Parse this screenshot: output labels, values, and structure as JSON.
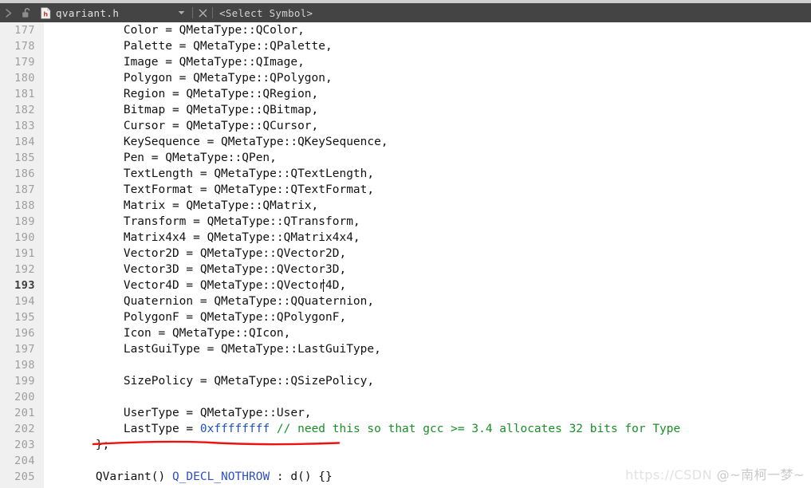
{
  "toolbar": {
    "nav_forward_icon": "chevron-right-icon",
    "lock_icon": "unlocked-padlock-icon",
    "file_type_icon": "header-file-icon",
    "file_type_letter": "h",
    "filename": "qvariant.h",
    "dropdown_icon": "chevron-down-icon",
    "close_icon": "close-x-icon",
    "select_symbol_label": "<Select Symbol>"
  },
  "editor": {
    "current_line": 193,
    "first_line": 177,
    "last_line": 205,
    "lines": [
      {
        "number": "177",
        "indent": "        ",
        "text": "Color = QMetaType::QColor,"
      },
      {
        "number": "178",
        "indent": "        ",
        "text": "Palette = QMetaType::QPalette,"
      },
      {
        "number": "179",
        "indent": "        ",
        "text": "Image = QMetaType::QImage,"
      },
      {
        "number": "180",
        "indent": "        ",
        "text": "Polygon = QMetaType::QPolygon,"
      },
      {
        "number": "181",
        "indent": "        ",
        "text": "Region = QMetaType::QRegion,"
      },
      {
        "number": "182",
        "indent": "        ",
        "text": "Bitmap = QMetaType::QBitmap,"
      },
      {
        "number": "183",
        "indent": "        ",
        "text": "Cursor = QMetaType::QCursor,"
      },
      {
        "number": "184",
        "indent": "        ",
        "text": "KeySequence = QMetaType::QKeySequence,"
      },
      {
        "number": "185",
        "indent": "        ",
        "text": "Pen = QMetaType::QPen,"
      },
      {
        "number": "186",
        "indent": "        ",
        "text": "TextLength = QMetaType::QTextLength,"
      },
      {
        "number": "187",
        "indent": "        ",
        "text": "TextFormat = QMetaType::QTextFormat,"
      },
      {
        "number": "188",
        "indent": "        ",
        "text": "Matrix = QMetaType::QMatrix,"
      },
      {
        "number": "189",
        "indent": "        ",
        "text": "Transform = QMetaType::QTransform,"
      },
      {
        "number": "190",
        "indent": "        ",
        "text": "Matrix4x4 = QMetaType::QMatrix4x4,"
      },
      {
        "number": "191",
        "indent": "        ",
        "text": "Vector2D = QMetaType::QVector2D,"
      },
      {
        "number": "192",
        "indent": "        ",
        "text": "Vector3D = QMetaType::QVector3D,"
      },
      {
        "number": "193",
        "indent": "        ",
        "text": "Vector4D = QMetaType::QVector4D,"
      },
      {
        "number": "194",
        "indent": "        ",
        "text": "Quaternion = QMetaType::QQuaternion,"
      },
      {
        "number": "195",
        "indent": "        ",
        "text": "PolygonF = QMetaType::QPolygonF,"
      },
      {
        "number": "196",
        "indent": "        ",
        "text": "Icon = QMetaType::QIcon,"
      },
      {
        "number": "197",
        "indent": "        ",
        "text": "LastGuiType = QMetaType::LastGuiType,"
      },
      {
        "number": "198",
        "indent": "",
        "text": ""
      },
      {
        "number": "199",
        "indent": "        ",
        "text": "SizePolicy = QMetaType::QSizePolicy,"
      },
      {
        "number": "200",
        "indent": "",
        "text": ""
      },
      {
        "number": "201",
        "indent": "        ",
        "text": "UserType = QMetaType::User,"
      },
      {
        "number": "202",
        "indent": "        ",
        "text": "LastType = 0xffffffff // need this so that gcc >= 3.4 allocates 32 bits for Type"
      },
      {
        "number": "203",
        "indent": "    ",
        "text": "};"
      },
      {
        "number": "204",
        "indent": "",
        "text": ""
      },
      {
        "number": "205",
        "indent": "    ",
        "text": "QVariant() Q_DECL_NOTHROW : d() {}"
      }
    ],
    "line_202_parts": {
      "plain_a": "        LastType = ",
      "number": "0xffffffff",
      "plain_b": " ",
      "comment": "// need this so that gcc >= 3.4 allocates 32 bits for Type"
    },
    "line_205_parts": {
      "plain_a": "    QVariant() ",
      "macro": "Q_DECL_NOTHROW",
      "plain_b": " : d() {}"
    }
  },
  "annotation": {
    "red_underline_target": "UserType = QMetaType::User,",
    "color": "#ee1111"
  },
  "watermark": {
    "prefix": "https://CSDN",
    "handle": "@~南柯一梦~"
  },
  "colors": {
    "toolbar_bg": "#444444",
    "gutter_bg": "#f0f0f0",
    "editor_bg": "#ffffff",
    "code_text": "#121212",
    "line_number": "#9d9d9d",
    "number_literal": "#1b52c4",
    "comment": "#1a8f27",
    "macro": "#2f4fc4",
    "annotation_red": "#ee1111"
  }
}
